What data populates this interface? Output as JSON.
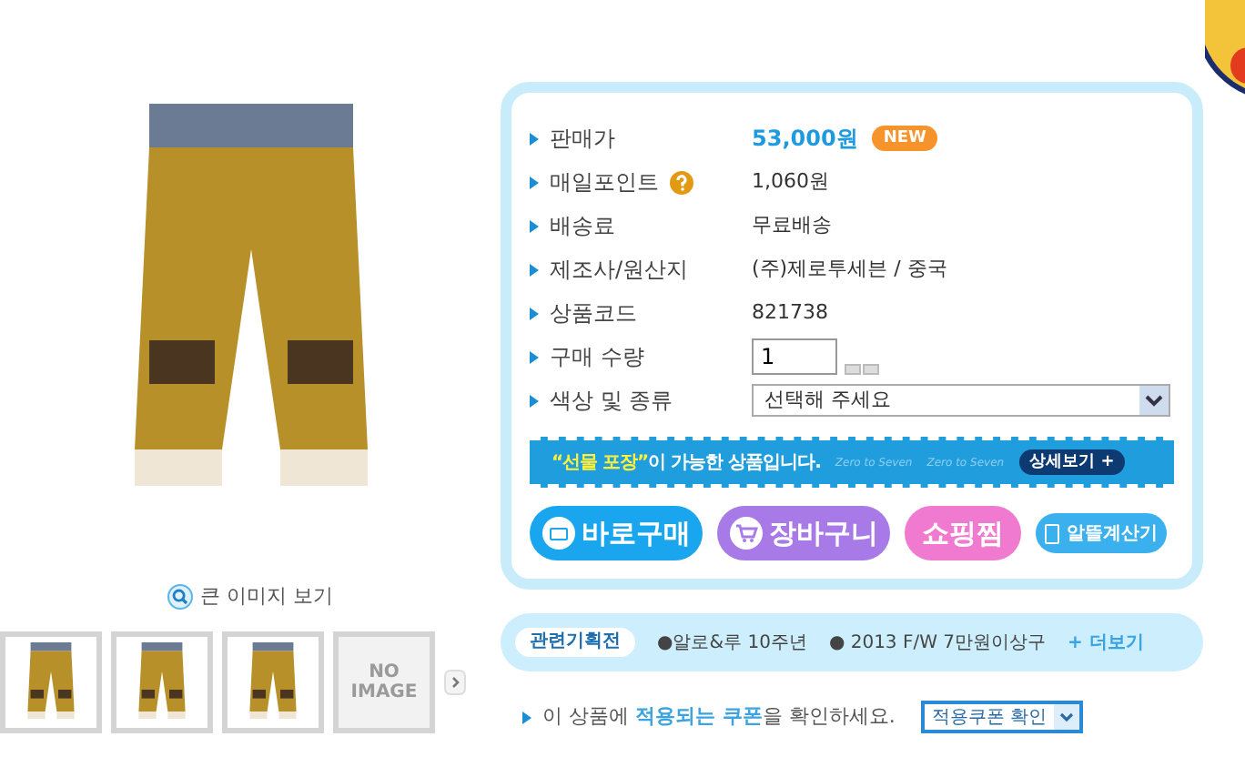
{
  "gallery": {
    "zoom_link": "큰 이미지 보기",
    "thumbnails": [
      {
        "kind": "photo"
      },
      {
        "kind": "photo"
      },
      {
        "kind": "photo"
      },
      {
        "kind": "empty",
        "label_1": "NO",
        "label_2": "IMAGE"
      }
    ]
  },
  "details": {
    "rows": [
      {
        "kind": "price",
        "label": "판매가",
        "value": "53,000원",
        "badge": "NEW"
      },
      {
        "kind": "points",
        "label": "매일포인트",
        "value": "1,060원"
      },
      {
        "kind": "text",
        "label": "배송료",
        "value": "무료배송"
      },
      {
        "kind": "text",
        "label": "제조사/원산지",
        "value": "(주)제로투세븐 / 중국"
      },
      {
        "kind": "text",
        "label": "상품코드",
        "value": "821738"
      },
      {
        "kind": "quantity",
        "label": "구매 수량",
        "value": "1"
      },
      {
        "kind": "select",
        "label": "색상 및 종류",
        "value": "선택해 주세요"
      }
    ],
    "gift_banner": {
      "highlight": "“선물 포장”",
      "text": "이 가능한 상품입니다.",
      "brand_1": "Zero to Seven",
      "brand_2": "Zero to Seven",
      "more": "상세보기 +"
    },
    "buttons": [
      {
        "kind": "buy",
        "label": "바로구매"
      },
      {
        "kind": "cart",
        "label": "장바구니"
      },
      {
        "kind": "wish",
        "label": "쇼핑찜"
      },
      {
        "kind": "calc",
        "label": "알뜰계산기"
      }
    ]
  },
  "related": {
    "tag": "관련기획전",
    "items": [
      "●알로&루 10주년",
      "● 2013 F/W 7만원이상구"
    ],
    "more": "+ 더보기"
  },
  "coupon": {
    "text": "이 상품에 **적용되는 쿠폰**을 확인하세요.",
    "select": "적용쿠폰 확인"
  }
}
